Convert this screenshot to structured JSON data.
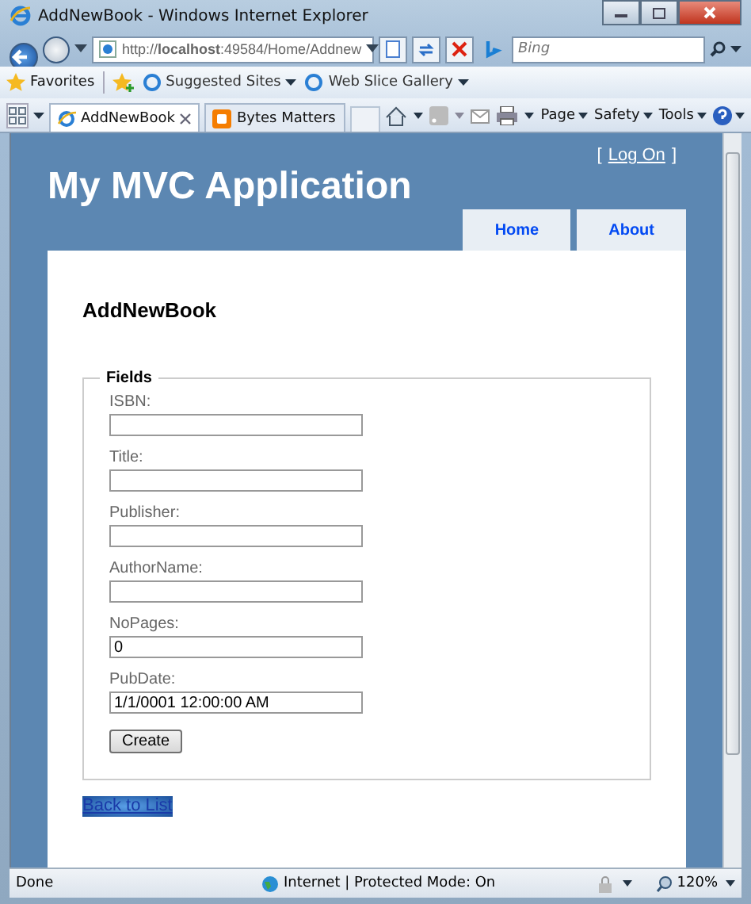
{
  "window": {
    "title": "AddNewBook - Windows Internet Explorer"
  },
  "address_bar": {
    "url": "http://**localhost**:49584/Home/Addnew",
    "search_placeholder": "Bing"
  },
  "favorites_bar": {
    "label": "Favorites",
    "links": [
      "Suggested Sites",
      "Web Slice Gallery"
    ]
  },
  "tabs": [
    {
      "label": "AddNewBook",
      "selected": true
    },
    {
      "label": "Bytes Matters",
      "selected": false
    }
  ],
  "command_bar": [
    "Page",
    "Safety",
    "Tools"
  ],
  "page": {
    "login": {
      "open": "[",
      "link": "Log On",
      "close": "]"
    },
    "title": "My MVC Application",
    "menu": [
      "Home",
      "About"
    ],
    "heading": "AddNewBook",
    "legend": "Fields",
    "fields": [
      {
        "label": "ISBN:"
      },
      {
        "label": "Title:"
      },
      {
        "label": "Publisher:"
      },
      {
        "label": "AuthorName:"
      },
      {
        "label": "NoPages:",
        "value": "0"
      },
      {
        "label": "PubDate:",
        "value": "1/1/0001 12:00:00 AM"
      }
    ],
    "submit": "Create",
    "back_link": "Back to List"
  },
  "status_bar": {
    "text": "Done",
    "zone": "Internet | Protected Mode: On",
    "zoom": "120%"
  }
}
